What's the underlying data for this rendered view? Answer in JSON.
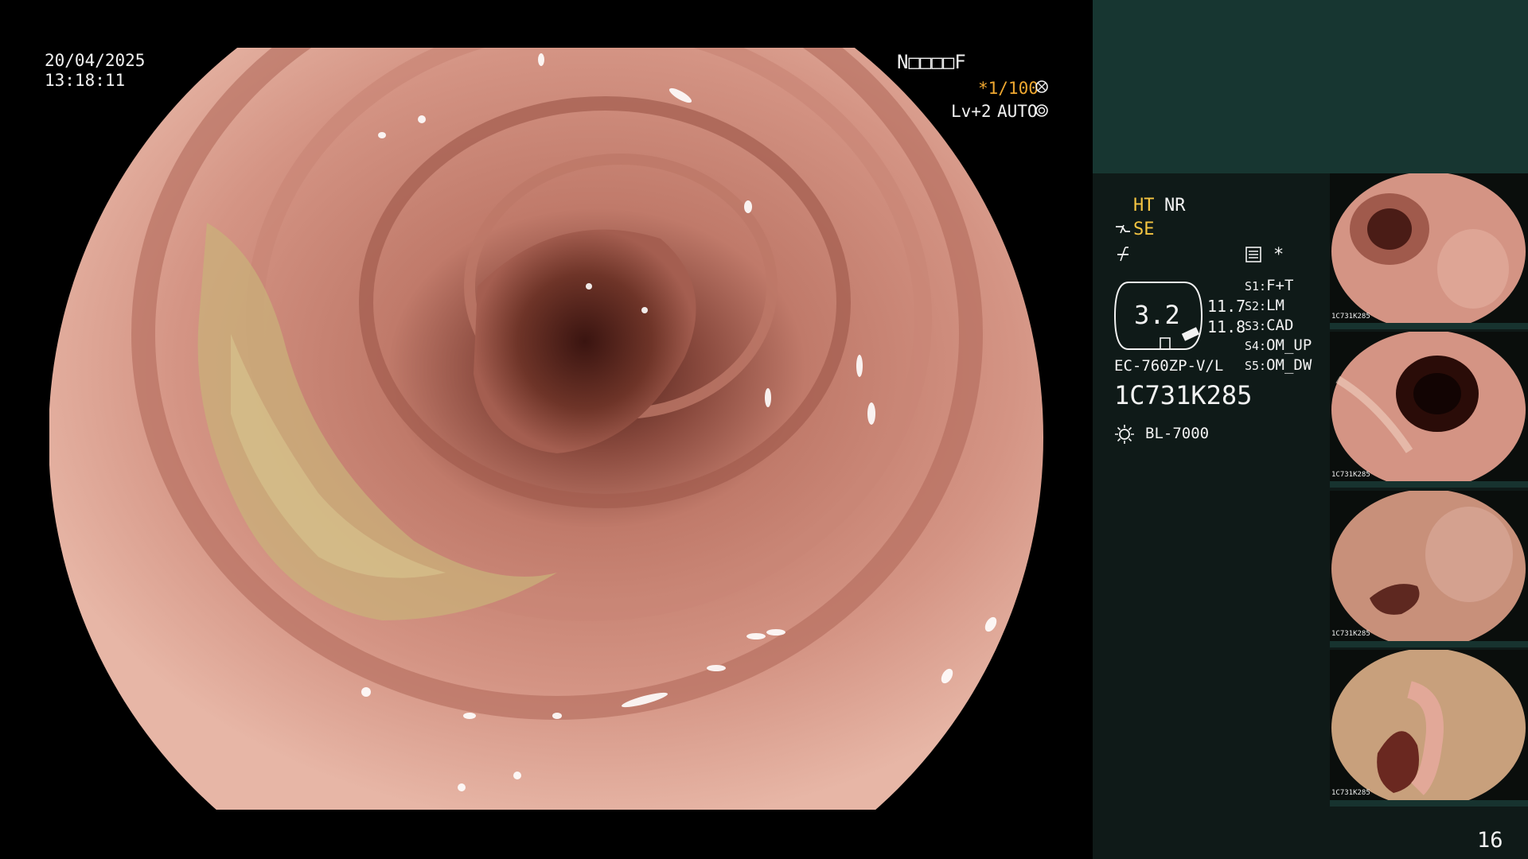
{
  "scope_view": {
    "date": "20/04/2025",
    "time": "13:18:11",
    "mode_code": "N□□□□F",
    "shutter": "*1/100",
    "light_level": "Lv+2",
    "iris_mode": "AUTO"
  },
  "side_panel": {
    "ht_label": "HT",
    "nr_label": "NR",
    "se_label": "SE",
    "star_label": "*",
    "zoom_value": "3.2",
    "value_1": "11.7",
    "value_2": "11.8",
    "scope_model": "EC-760ZP-V/L",
    "serial": "1C731K285",
    "light_source": "BL-7000",
    "shortcuts": [
      {
        "key": "S1:",
        "value": "F+T"
      },
      {
        "key": "S2:",
        "value": "LM"
      },
      {
        "key": "S3:",
        "value": "CAD"
      },
      {
        "key": "S4:",
        "value": "OM_UP"
      },
      {
        "key": "S5:",
        "value": "OM_DW"
      }
    ],
    "image_count": "16"
  },
  "thumbnails": [
    {
      "label": "1C731K285"
    },
    {
      "label": "1C731K285"
    },
    {
      "label": "1C731K285"
    },
    {
      "label": "1C731K285"
    }
  ],
  "colors": {
    "panel_bg": "#0f1a18",
    "panel_header": "#173631",
    "accent_yellow": "#f5c542",
    "mucosa": "#d08878"
  }
}
